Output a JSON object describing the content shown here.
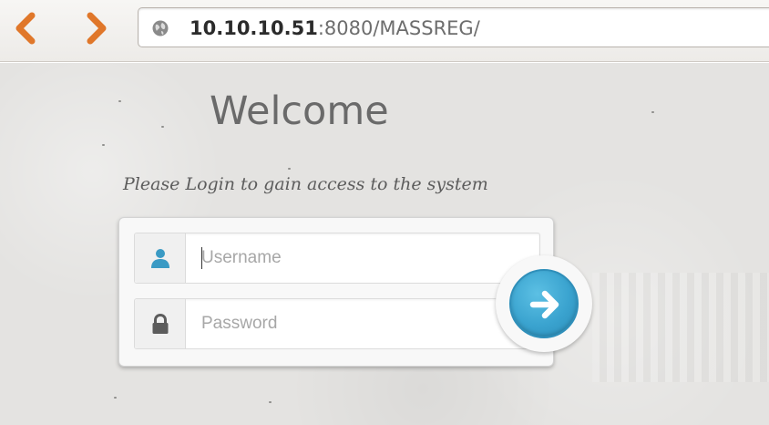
{
  "browser": {
    "url_host": "10.10.10.51",
    "url_rest": ":8080/MASSREG/",
    "back_icon": "chevron-left-icon",
    "forward_icon": "chevron-right-icon",
    "site_icon": "globe-icon",
    "nav_color": "#e0772a"
  },
  "page": {
    "title": "Welcome",
    "subtitle": "Please Login to gain access to the system"
  },
  "login": {
    "username": {
      "value": "",
      "placeholder": "Username",
      "icon": "user-icon"
    },
    "password": {
      "value": "",
      "placeholder": "Password",
      "icon": "lock-icon"
    },
    "submit_icon": "arrow-right-icon",
    "accent_color": "#3aa3cf"
  }
}
